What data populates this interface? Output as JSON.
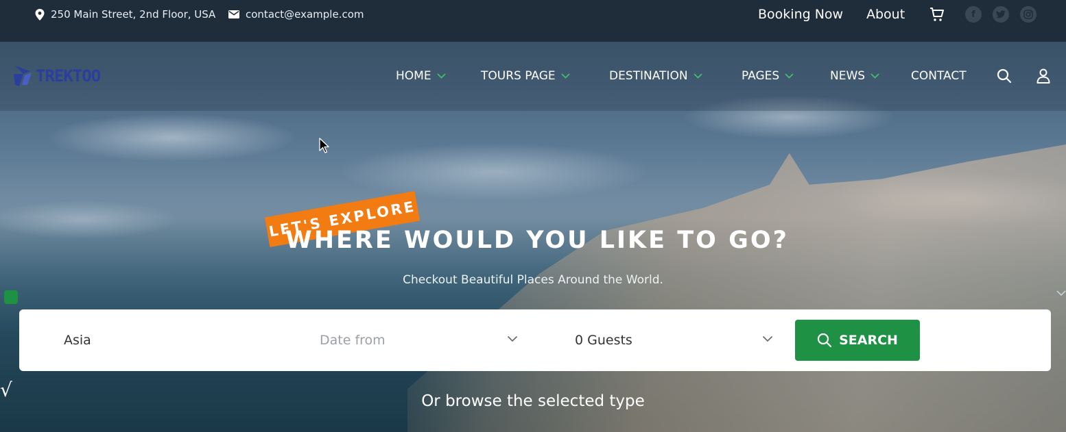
{
  "topbar": {
    "address": "250 Main Street, 2nd Floor, USA",
    "email": "contact@example.com",
    "booking_link": "Booking Now",
    "about_link": "About",
    "icons": [
      "location-pin-icon",
      "envelope-icon",
      "cart-icon",
      "facebook-icon",
      "twitter-icon",
      "instagram-icon"
    ]
  },
  "brand": {
    "name": "TREKTOO"
  },
  "nav": {
    "items": [
      {
        "label": "HOME",
        "has_dropdown": true
      },
      {
        "label": "TOURS PAGE",
        "has_dropdown": true
      },
      {
        "label": "DESTINATION",
        "has_dropdown": true
      },
      {
        "label": "PAGES",
        "has_dropdown": true
      },
      {
        "label": "NEWS",
        "has_dropdown": true
      },
      {
        "label": "CONTACT",
        "has_dropdown": false
      }
    ]
  },
  "hero": {
    "tag": "LET'S EXPLORE",
    "title": "WHERE WOULD YOU LIKE TO GO?",
    "subtitle": "Checkout Beautiful Places Around the World.",
    "browse_text": "Or browse the selected type"
  },
  "search": {
    "destination_value": "Asia",
    "date_placeholder": "Date from",
    "guests_value": "0 Guests",
    "button_label": "SEARCH"
  },
  "colors": {
    "topbar_bg": "#1f2d3b",
    "accent_orange": "#f27b12",
    "accent_green": "#1f9145",
    "logo_blue": "#2b3e9c",
    "nav_chevron_green": "#3fbf6b"
  }
}
